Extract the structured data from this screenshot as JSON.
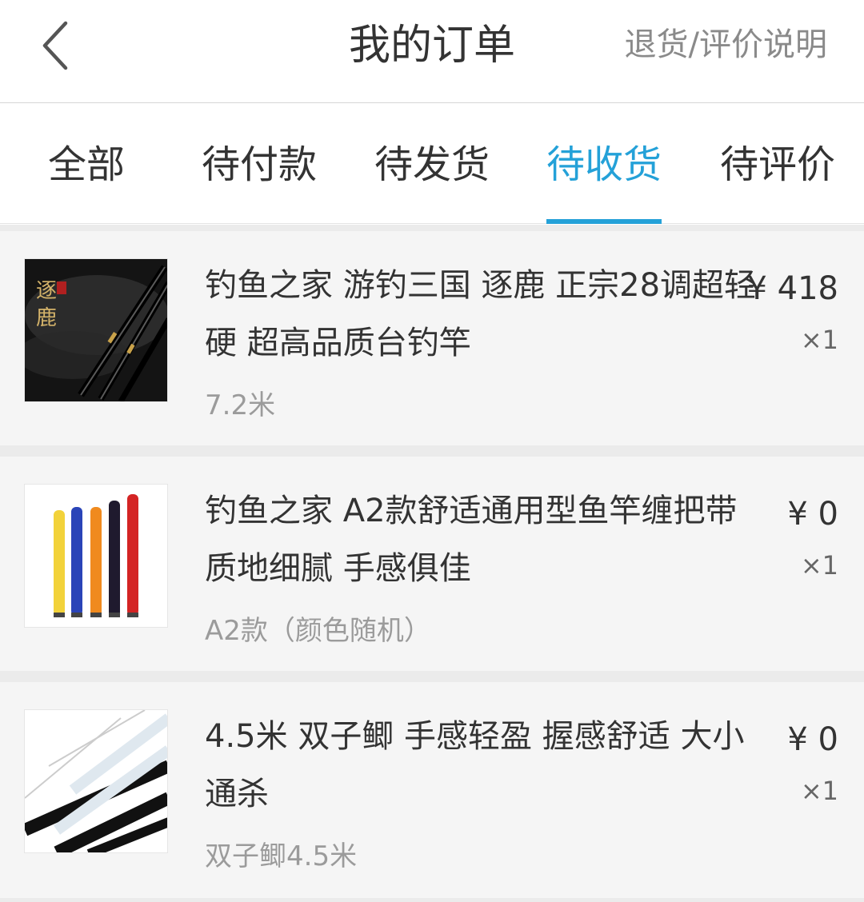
{
  "header": {
    "title": "我的订单",
    "help_link": "退货/评价说明",
    "back_icon": "chevron-left-icon"
  },
  "tabs": [
    {
      "label": "全部",
      "active": false
    },
    {
      "label": "待付款",
      "active": false
    },
    {
      "label": "待发货",
      "active": false
    },
    {
      "label": "待收货",
      "active": true
    },
    {
      "label": "待评价",
      "active": false
    }
  ],
  "accent_color": "#24a1d8",
  "orders": [
    {
      "name": "钓鱼之家 游钓三国 逐鹿 正宗28调超轻硬 超高品质台钓竿",
      "spec": "7.2米",
      "price": "¥ 418",
      "qty": "×1",
      "image": "fishing-rod-product-image"
    },
    {
      "name": "钓鱼之家 A2款舒适通用型鱼竿缠把带 质地细腻 手感俱佳",
      "spec": "A2款（颜色随机）",
      "price": "¥ 0",
      "qty": "×1",
      "image": "grip-tape-product-image"
    },
    {
      "name": "4.5米 双子鲫 手感轻盈 握感舒适 大小通杀",
      "spec": "双子鲫4.5米",
      "price": "¥ 0",
      "qty": "×1",
      "image": "fishing-pole-product-image"
    }
  ]
}
